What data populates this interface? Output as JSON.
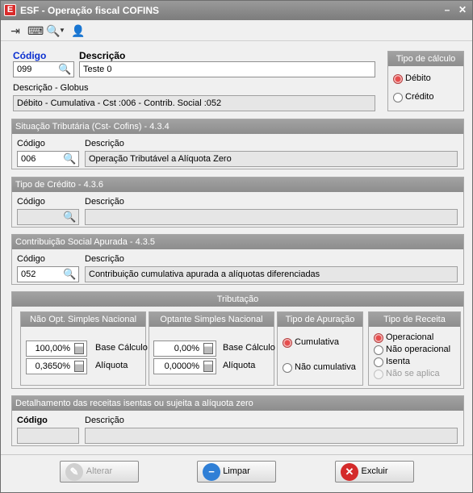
{
  "window": {
    "title": "ESF - Operação fiscal COFINS",
    "app_icon": "E",
    "minimize_glyph": "–",
    "close_glyph": "✕"
  },
  "toolbar": {
    "icons": [
      "exit-icon",
      "keyboard-icon",
      "search-icon",
      "user-icon"
    ]
  },
  "header": {
    "codigo_label": "Código",
    "codigo_value": "099",
    "descricao_label": "Descrição",
    "descricao_value": "Teste 0",
    "globus_label": "Descrição - Globus",
    "globus_value": "Débito - Cumulativa - Cst :006 - Contrib. Social :052"
  },
  "tipo_calculo": {
    "title": "Tipo de cálculo",
    "options": [
      "Débito",
      "Crédito"
    ],
    "selected": "Débito"
  },
  "situacao": {
    "title": "Situação Tributária (Cst- Cofins) - 4.3.4",
    "codigo_label": "Código",
    "codigo_value": "006",
    "descricao_label": "Descrição",
    "descricao_value": "Operação Tributável a Alíquota Zero"
  },
  "credito": {
    "title": "Tipo de Crédito - 4.3.6",
    "codigo_label": "Código",
    "codigo_value": "",
    "descricao_label": "Descrição",
    "descricao_value": ""
  },
  "contribuicao": {
    "title": "Contribuição Social Apurada - 4.3.5",
    "codigo_label": "Código",
    "codigo_value": "052",
    "descricao_label": "Descrição",
    "descricao_value": "Contribuição cumulativa apurada a alíquotas diferenciadas"
  },
  "tributacao": {
    "title": "Tributação",
    "nao_opt": {
      "title": "Não Opt. Simples Nacional",
      "base_value": "100,00%",
      "base_label": "Base Cálculo",
      "aliq_value": "0,3650%",
      "aliq_label": "Alíquota"
    },
    "optante": {
      "title": "Optante Simples Nacional",
      "base_value": "0,00%",
      "base_label": "Base Cálculo",
      "aliq_value": "0,0000%",
      "aliq_label": "Alíquota"
    },
    "apuracao": {
      "title": "Tipo de Apuração",
      "options": [
        "Cumulativa",
        "Não cumulativa"
      ],
      "selected": "Cumulativa"
    },
    "receita": {
      "title": "Tipo de Receita",
      "options": [
        "Operacional",
        "Não operacional",
        "Isenta",
        "Não se aplica"
      ],
      "selected": "Operacional",
      "disabled": "Não se aplica"
    }
  },
  "detalhamento": {
    "title": "Detalhamento das receitas isentas ou sujeita a alíquota zero",
    "codigo_label": "Código",
    "codigo_value": "",
    "descricao_label": "Descrição",
    "descricao_value": ""
  },
  "buttons": {
    "alterar": "Alterar",
    "limpar": "Limpar",
    "excluir": "Excluir"
  },
  "colors": {
    "title_bar": "#8d8d8d",
    "group_header": "#989898",
    "radio_selected": "#e64e4e",
    "codigo_label": "#0a2fd0",
    "limpar_icon": "#2f7fd6",
    "excluir_icon": "#d42a2a"
  }
}
